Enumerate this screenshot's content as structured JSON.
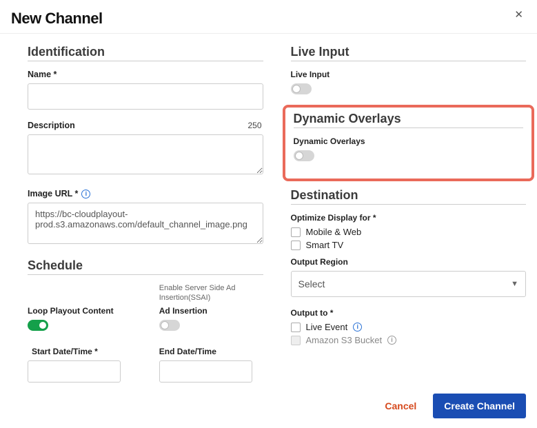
{
  "header": {
    "title": "New Channel"
  },
  "identification": {
    "title": "Identification",
    "name_label": "Name *",
    "name_value": "",
    "description_label": "Description",
    "description_count": "250",
    "description_value": "",
    "image_url_label": "Image URL *",
    "image_url_value": "https://bc-cloudplayout-prod.s3.amazonaws.com/default_channel_image.png"
  },
  "schedule": {
    "title": "Schedule",
    "loop_label": "Loop Playout Content",
    "ssai_sub": "Enable Server Side Ad Insertion(SSAI)",
    "ad_label": "Ad Insertion",
    "start_label": "Start Date/Time *",
    "end_label": "End Date/Time",
    "start_value": "",
    "end_value": ""
  },
  "live_input": {
    "title": "Live Input",
    "label": "Live Input"
  },
  "dynamic_overlays": {
    "title": "Dynamic Overlays",
    "label": "Dynamic Overlays"
  },
  "destination": {
    "title": "Destination",
    "optimize_label": "Optimize Display for *",
    "opt1": "Mobile & Web",
    "opt2": "Smart TV",
    "region_label": "Output Region",
    "region_value": "Select",
    "output_to_label": "Output to *",
    "out1": "Live Event",
    "out2": "Amazon S3 Bucket"
  },
  "footer": {
    "cancel": "Cancel",
    "create": "Create Channel"
  }
}
